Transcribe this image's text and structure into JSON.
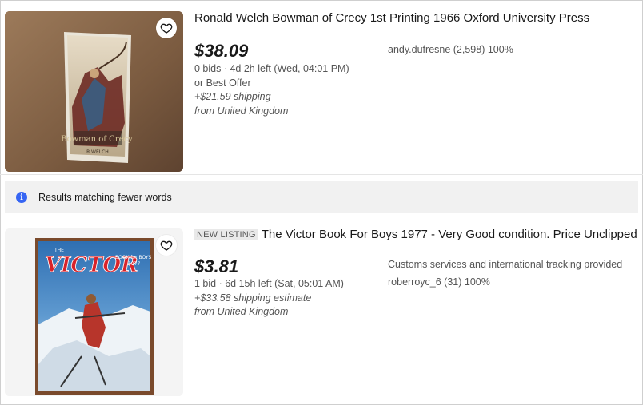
{
  "listings": [
    {
      "title": "Ronald Welch Bowman of Crecy 1st Printing 1966 Oxford University Press",
      "price": "$38.09",
      "bids_time": "0 bids · 4d 2h left (Wed, 04:01 PM)",
      "best_offer": "or Best Offer",
      "shipping": "+$21.59 shipping",
      "location": "from United Kingdom",
      "seller": "andy.dufresne (2,598) 100%",
      "image_label": "Bowman of Crecy",
      "image_author": "R.WELCH"
    },
    {
      "badge": "NEW LISTING",
      "title": "The Victor Book For Boys 1977 - Very Good condition. Price Unclipped",
      "price": "$3.81",
      "bids_time": "1 bid · 6d 15h left (Sat, 05:01 AM)",
      "shipping": "+$33.58 shipping estimate",
      "location": "from United Kingdom",
      "customs_note": "Customs services and international tracking provided",
      "seller": "roberroyc_6 (31) 100%",
      "image_label": "VICTOR",
      "image_sub_top": "THE",
      "image_sub": "BOOK for BOYS",
      "image_year": "1977"
    }
  ],
  "banner": {
    "text": "Results matching fewer words",
    "icon": "info-icon"
  },
  "colors": {
    "accent": "#3665f3",
    "banner_bg": "#f1f1f1"
  }
}
